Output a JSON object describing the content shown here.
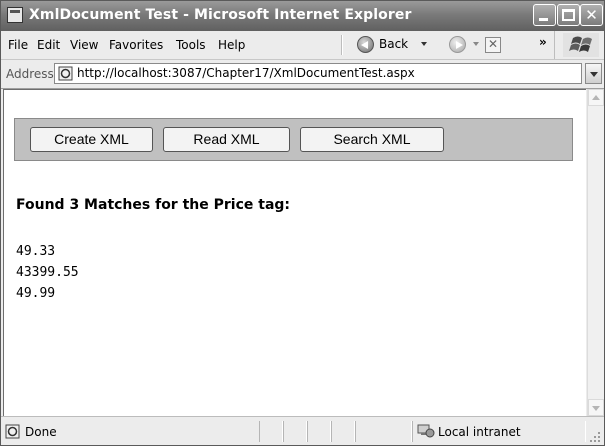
{
  "window": {
    "title": "XmlDocument Test - Microsoft Internet Explorer"
  },
  "menu": {
    "items": [
      "File",
      "Edit",
      "View",
      "Favorites",
      "Tools",
      "Help"
    ]
  },
  "toolbar": {
    "back_label": "Back",
    "more_chevron": "»"
  },
  "address": {
    "label": "Address",
    "url": "http://localhost:3087/Chapter17/XmlDocumentTest.aspx"
  },
  "page": {
    "buttons": [
      "Create XML",
      "Read XML",
      "Search XML"
    ],
    "heading": "Found 3 Matches for the Price tag:",
    "results": [
      "49.33",
      "43399.55",
      "49.99"
    ]
  },
  "status": {
    "text": "Done",
    "zone": "Local intranet"
  },
  "icons": {
    "title": "ie-page-icon",
    "back": "back-arrow-icon",
    "forward": "forward-arrow-icon",
    "stop": "stop-icon",
    "logo": "windows-flag-logo",
    "address_page": "ie-page-icon",
    "status_page": "ie-page-icon",
    "zone": "intranet-zone-icon"
  }
}
